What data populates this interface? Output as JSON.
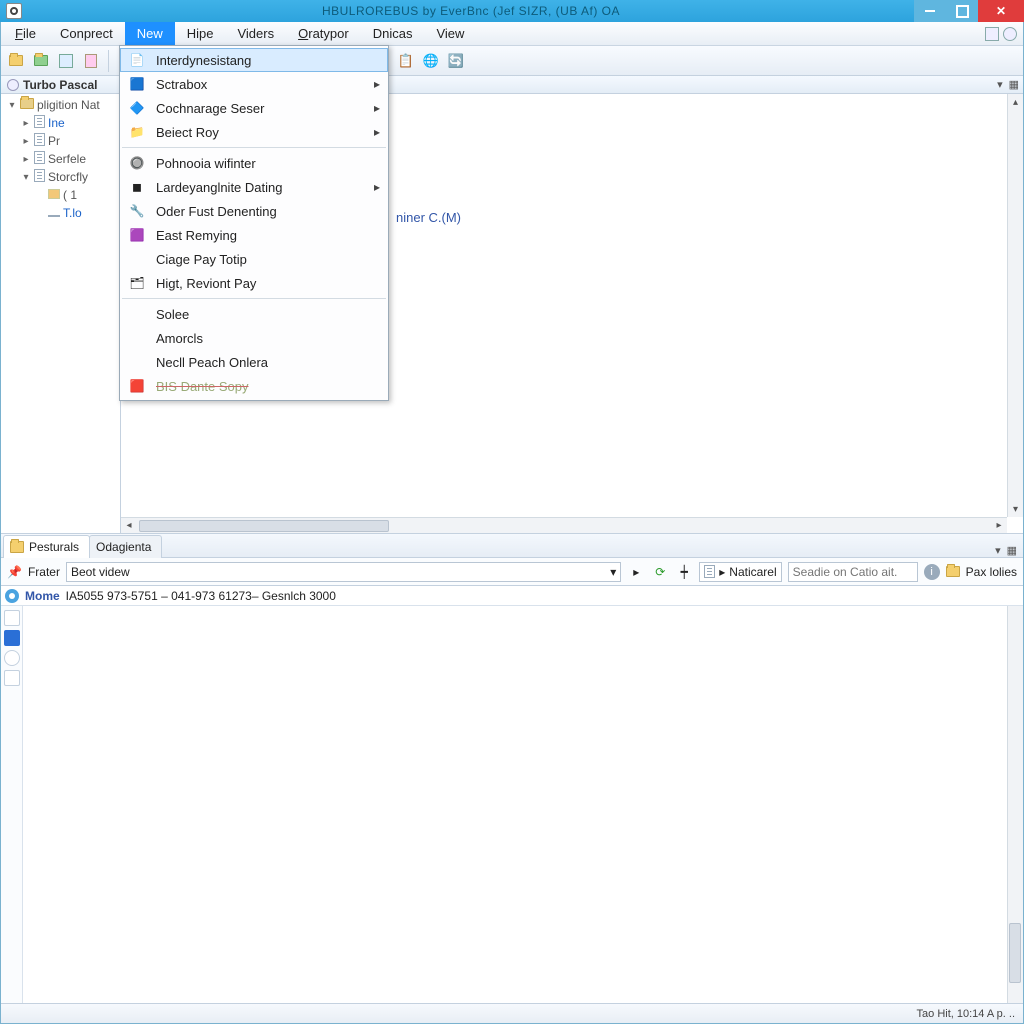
{
  "window": {
    "title": "HBULROREBUS by EverBnc (Jef SIZR, (UB Af) OA"
  },
  "menubar": {
    "items": [
      "File",
      "Conprect",
      "New",
      "Hipe",
      "Viders",
      "Oratypor",
      "Dnicas",
      "View"
    ],
    "active_index": 2
  },
  "dropdown": {
    "items": [
      {
        "label": "Interdynesistang",
        "icon": "📄",
        "hover": true
      },
      {
        "label": "Sctrabox",
        "icon": "🟦",
        "submenu": true
      },
      {
        "label": "Cochnarage Seser",
        "icon": "🔷",
        "submenu": true
      },
      {
        "label": "Beiect Roy",
        "icon": "📁",
        "submenu": true
      },
      {
        "sep": true
      },
      {
        "label": "Pohnooia wifinter",
        "icon": "🔘"
      },
      {
        "label": "Lardeyanglnite Dating",
        "icon": "◼",
        "submenu": true
      },
      {
        "label": "Oder Fust Denenting",
        "icon": "🔧"
      },
      {
        "label": "East Remying",
        "icon": "🟪"
      },
      {
        "label": "Ciage Pay Totip",
        "icon": ""
      },
      {
        "label": "Higt, Reviont Pay",
        "icon": "🗂"
      },
      {
        "sep": true
      },
      {
        "label": "Solee",
        "icon": ""
      },
      {
        "label": "Amorcls",
        "icon": ""
      },
      {
        "label": "Necll Peach Onlera",
        "icon": ""
      },
      {
        "label": "BIS Dante Sopy",
        "icon": "🟥",
        "dim": true
      }
    ],
    "highlight_start": 12,
    "highlight_end": 15
  },
  "sidebar": {
    "title": "Turbo Pascal",
    "tree": [
      {
        "indent": 0,
        "arrow": "▾",
        "icon": "pkg",
        "label": "pligition Nat",
        "cls": "lbl-gray"
      },
      {
        "indent": 1,
        "arrow": "▸",
        "icon": "file",
        "label": "Ine",
        "cls": "lbl-blue"
      },
      {
        "indent": 1,
        "arrow": "▸",
        "icon": "file",
        "label": "Pr",
        "cls": "lbl-gray"
      },
      {
        "indent": 1,
        "arrow": "▸",
        "icon": "file",
        "label": "Serfele",
        "cls": "lbl-gray"
      },
      {
        "indent": 1,
        "arrow": "▾",
        "icon": "file",
        "label": "Storcfly",
        "cls": "lbl-gray"
      },
      {
        "indent": 2,
        "arrow": "",
        "icon": "brk",
        "label": "( 1",
        "cls": "lbl-gray"
      },
      {
        "indent": 2,
        "arrow": "",
        "icon": "line",
        "label": "T.lo",
        "cls": "lbl-blue"
      }
    ]
  },
  "doc": {
    "snippet": "niner C.(M)"
  },
  "bottom": {
    "tabs": [
      {
        "label": "Pesturals",
        "active": true
      },
      {
        "label": "Odagienta",
        "active": false
      }
    ],
    "filter_label": "Frater",
    "filter_value": "Beot videw",
    "mode_label": "Naticarel",
    "search_placeholder": "Seadie on Catio ait.",
    "right_label": "Pax lolies",
    "row_key": "Mome",
    "row_val": "IA5055 973-5751 – 041-973 61273– Gesnlch 3000"
  },
  "status": {
    "text": "Tao Hit, 10:14 A p.   .."
  }
}
